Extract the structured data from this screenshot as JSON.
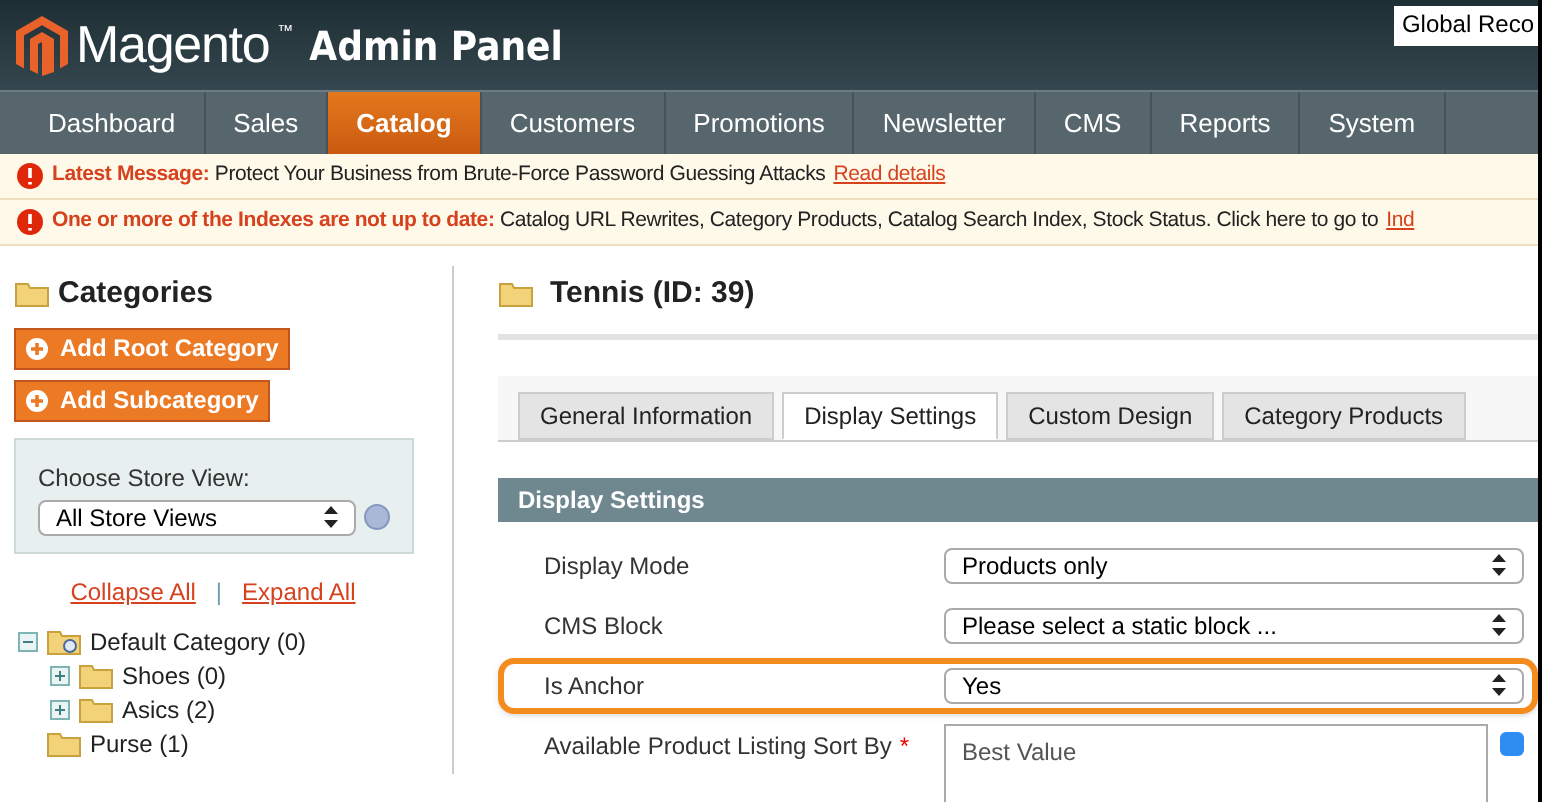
{
  "header": {
    "logo": "Magento",
    "logo_tm": "™",
    "subtitle": "Admin Panel",
    "scope": "Global Reco"
  },
  "nav": [
    {
      "label": "Dashboard",
      "selected": false
    },
    {
      "label": "Sales",
      "selected": false
    },
    {
      "label": "Catalog",
      "selected": true
    },
    {
      "label": "Customers",
      "selected": false
    },
    {
      "label": "Promotions",
      "selected": false
    },
    {
      "label": "Newsletter",
      "selected": false
    },
    {
      "label": "CMS",
      "selected": false
    },
    {
      "label": "Reports",
      "selected": false
    },
    {
      "label": "System",
      "selected": false
    }
  ],
  "messages": [
    {
      "text": "**Latest Message:** Protect Your Business from Brute-Force Password Guessing Attacks",
      "link": "Read details"
    },
    {
      "text": "**One or more of the Indexes are not up to date:** Catalog URL Rewrites, Category Products, Catalog Search Index, Stock Status. Click here to go to",
      "link": "Ind"
    }
  ],
  "sidebar": {
    "title": "Categories",
    "buttons": [
      "Add Root Category",
      "Add Subcategory"
    ],
    "store_view_label": "Choose Store View:",
    "store_view": "All Store Views",
    "links": [
      "Collapse All",
      "|",
      "Expand All"
    ],
    "tree": [
      {
        "label": "Default Category (0)",
        "expanded": true,
        "children": [
          {
            "label": "Shoes (0)",
            "expanded": false
          },
          {
            "label": "Asics (2)",
            "expanded": false
          }
        ]
      },
      {
        "label": "Purse (1)"
      }
    ]
  },
  "main": {
    "title": "Tennis (ID: 39)",
    "tabs": [
      {
        "label": "General Information",
        "selected": false
      },
      {
        "label": "Display Settings",
        "selected": true
      },
      {
        "label": "Custom Design",
        "selected": false
      },
      {
        "label": "Category Products",
        "selected": false
      }
    ],
    "section": "Display Settings",
    "fields": [
      {
        "label": "Display Mode",
        "value": "Products only",
        "kind": "select",
        "highlighted": false
      },
      {
        "label": "CMS Block",
        "value": "Please select a static block ...",
        "kind": "select",
        "highlighted": false
      },
      {
        "label": "Is Anchor",
        "value": "Yes",
        "kind": "select",
        "highlighted": true
      },
      {
        "label": "Available Product Listing Sort By",
        "required": "*",
        "value": "Best Value",
        "kind": "list",
        "checked": true
      }
    ]
  }
}
